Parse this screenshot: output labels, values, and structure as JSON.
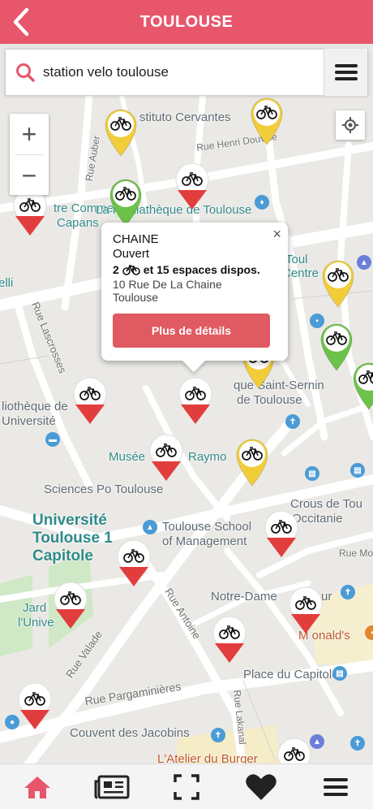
{
  "header": {
    "title": "TOULOUSE",
    "color": "#e8566c"
  },
  "search": {
    "value": "station velo toulouse"
  },
  "map": {
    "labels": {
      "cervantes": "stituto Cervantes",
      "henri": "Rue Henri Douvillé",
      "commercial": "tre Commercial",
      "capans": "Capans",
      "mediatheque": "La Médiathèque de Toulouse",
      "elli": "elli",
      "centre": "Centre",
      "toul": "Toul",
      "lascrosses": "Rue Lascrosses",
      "saturnin": "que Saint-Sernin",
      "detoulouse": "de Toulouse",
      "biblio": "liothèque de",
      "universite": "Université",
      "musee": "Musée",
      "raymo": "Raymo",
      "sciencespo": "Sciences Po Toulouse",
      "crous": "Crous de Tou",
      "occitanie": "Occitanie",
      "univ_big": "Université Toulouse 1 Capitole",
      "school": "Toulouse School",
      "management": "of Management",
      "ruemo": "Rue Mo",
      "jardin": "Jard",
      "luniv": "l'Unive",
      "antoine": "Rue Antoine",
      "notredame": "Notre-Dame",
      "ur": "ur",
      "valade": "Rue Valade",
      "mcdonalds": "M  onald's",
      "pargaminieres": "Rue Pargaminières",
      "capitole": "Place du Capitole",
      "lakanal": "Rue Lakanal",
      "jacobins": "Couvent des Jacobins",
      "burger": "L'Atelier du Burger",
      "aubert": "Rue Auber"
    },
    "markers": [
      {
        "id": "m1",
        "status": "yellow"
      },
      {
        "id": "m2",
        "status": "red"
      },
      {
        "id": "m3",
        "status": "green"
      },
      {
        "id": "m4",
        "status": "red"
      },
      {
        "id": "m5",
        "status": "yellow"
      },
      {
        "id": "m6",
        "status": "yellow"
      },
      {
        "id": "m7",
        "status": "green"
      },
      {
        "id": "m8",
        "status": "green"
      },
      {
        "id": "m9",
        "status": "yellow"
      },
      {
        "id": "m10",
        "status": "red"
      },
      {
        "id": "m11",
        "status": "red"
      },
      {
        "id": "m12",
        "status": "red"
      },
      {
        "id": "m13",
        "status": "yellow"
      },
      {
        "id": "m14",
        "status": "red"
      },
      {
        "id": "m15",
        "status": "red"
      },
      {
        "id": "m16",
        "status": "red"
      },
      {
        "id": "m17",
        "status": "red"
      },
      {
        "id": "m18",
        "status": "red"
      },
      {
        "id": "m19",
        "status": "red"
      },
      {
        "id": "m20",
        "status": "red"
      }
    ],
    "colors": {
      "yellow": "#f2cd3a",
      "green": "#6cc24a",
      "red": "#e23d3d"
    }
  },
  "popup": {
    "name": "CHAINE",
    "status": "Ouvert",
    "bikes": "2",
    "avail_text": "et 15 espaces dispos.",
    "address_line1": "10 Rue De La Chaine",
    "address_line2": "Toulouse",
    "button": "Plus de détails",
    "close": "×"
  },
  "bottom_nav": {
    "items": [
      "home-icon",
      "newspaper-icon",
      "scan-icon",
      "heart-icon",
      "menu-icon"
    ]
  }
}
